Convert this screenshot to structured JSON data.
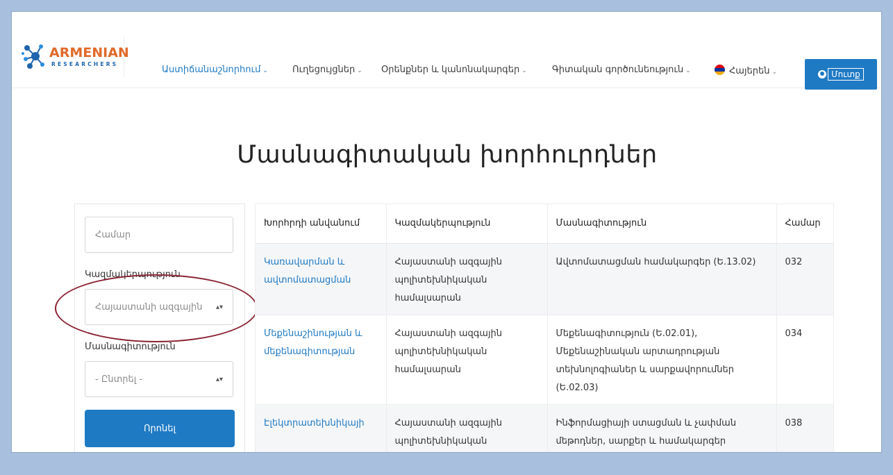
{
  "logo": {
    "title": "ARMENIAN",
    "subtitle": "RESEARCHERS"
  },
  "nav": {
    "items": [
      {
        "label": "Աստիճանաշնորհում",
        "active": true
      },
      {
        "label": "Ուղեցույցներ",
        "active": false
      },
      {
        "label": "Օրենքներ և կանոնակարգեր",
        "active": false
      },
      {
        "label": "Գիտական գործունեություն",
        "active": false
      }
    ],
    "language": "Հայերեն",
    "login": "Մուտք"
  },
  "page": {
    "title": "Մասնագիտական խորհուրդներ"
  },
  "filters": {
    "number_placeholder": "Համար",
    "organization_label": "Կազմակերպություն",
    "organization_value": "Հայաստանի ազգային",
    "specialty_label": "Մասնագիտություն",
    "specialty_value": "- Ընտրել -",
    "search_button": "Որոնել"
  },
  "table": {
    "headers": [
      "Խորհրդի անվանում",
      "Կազմակերպություն",
      "Մասնագիտություն",
      "Համար"
    ],
    "rows": [
      {
        "name": "Կառավարման և ավտոմատացման",
        "org": "Հայաստանի ազգային պոլիտեխնիկական համալսարան",
        "specialty": "Ավտոմատացման համակարգեր (Ե.13.02)",
        "number": "032"
      },
      {
        "name": "Մեքենաշինության և մեքենագիտության",
        "org": "Հայաստանի ազգային պոլիտեխնիկական համալսարան",
        "specialty": "Մեքենագիտություն (Ե.02.01), Մեքենաշինական արտադրության տեխնոլոգիաներ և սարքավորումներ (Ե.02.03)",
        "number": "034"
      },
      {
        "name": "Էլեկտրատեխնիկայի",
        "org": "Հայաստանի ազգային պոլիտեխնիկական",
        "specialty": "Ինֆորմացիայի ստացման և չափման մեթոդներ, սարքեր և համակարգեր",
        "number": "038"
      }
    ]
  },
  "colors": {
    "accent": "#1f7ac4",
    "annotation": "#8a2030",
    "background": "#a9bfde"
  }
}
